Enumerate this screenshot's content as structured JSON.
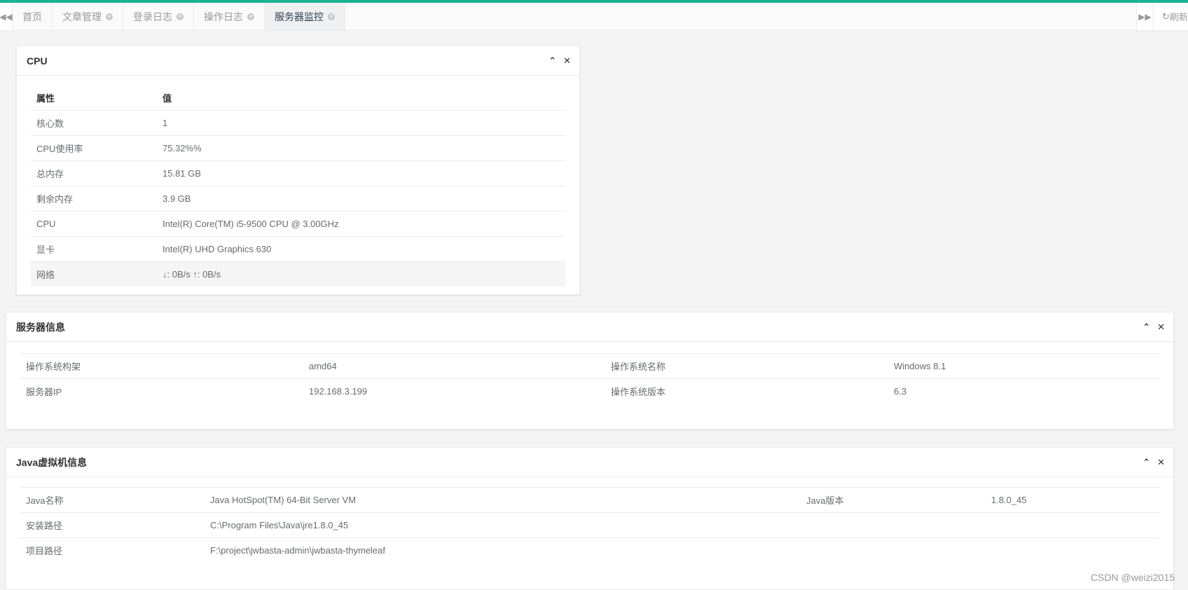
{
  "tabs": [
    {
      "label": "首页",
      "closable": false,
      "active": false
    },
    {
      "label": "文章管理",
      "closable": true,
      "active": false
    },
    {
      "label": "登录日志",
      "closable": true,
      "active": false
    },
    {
      "label": "操作日志",
      "closable": true,
      "active": false
    },
    {
      "label": "服务器监控",
      "closable": true,
      "active": true
    }
  ],
  "toolbar": {
    "refresh_label": "刷新"
  },
  "cpu_panel": {
    "title": "CPU",
    "header": {
      "prop": "属性",
      "value": "值"
    },
    "rows": [
      {
        "prop": "核心数",
        "value": "1"
      },
      {
        "prop": "CPU使用率",
        "value": "75.32%%"
      },
      {
        "prop": "总内存",
        "value": "15.81 GB"
      },
      {
        "prop": "剩余内存",
        "value": "3.9 GB"
      },
      {
        "prop": "CPU",
        "value": "Intel(R) Core(TM) i5-9500 CPU @ 3.00GHz"
      },
      {
        "prop": "显卡",
        "value": "Intel(R) UHD Graphics 630"
      },
      {
        "prop": "网络",
        "value": "↓: 0B/s ↑: 0B/s"
      }
    ]
  },
  "server_panel": {
    "title": "服务器信息",
    "rows": [
      {
        "k1": "操作系统构架",
        "v1": "amd64",
        "k2": "操作系统名称",
        "v2": "Windows 8.1"
      },
      {
        "k1": "服务器IP",
        "v1": "192.168.3.199",
        "k2": "操作系统版本",
        "v2": "6.3"
      }
    ]
  },
  "jvm_panel": {
    "title": "Java虚拟机信息",
    "rows": [
      {
        "k1": "Java名称",
        "v1": "Java HotSpot(TM) 64-Bit Server VM",
        "k2": "Java版本",
        "v2": "1.8.0_45"
      },
      {
        "k1": "安装路径",
        "v1": "C:\\Program Files\\Java\\jre1.8.0_45",
        "k2": "",
        "v2": ""
      },
      {
        "k1": "项目路径",
        "v1": "F:\\project\\jwbasta-admin\\jwbasta-thymeleaf",
        "k2": "",
        "v2": ""
      }
    ]
  },
  "watermark": "CSDN @weizi2015",
  "colors": {
    "accent": "#1ab394",
    "active_tab_text": "#2f4050"
  },
  "icons": {
    "prev": "backward-icon",
    "next": "forward-icon",
    "refresh": "refresh-icon",
    "collapse": "chevron-up-icon",
    "close": "close-icon"
  }
}
